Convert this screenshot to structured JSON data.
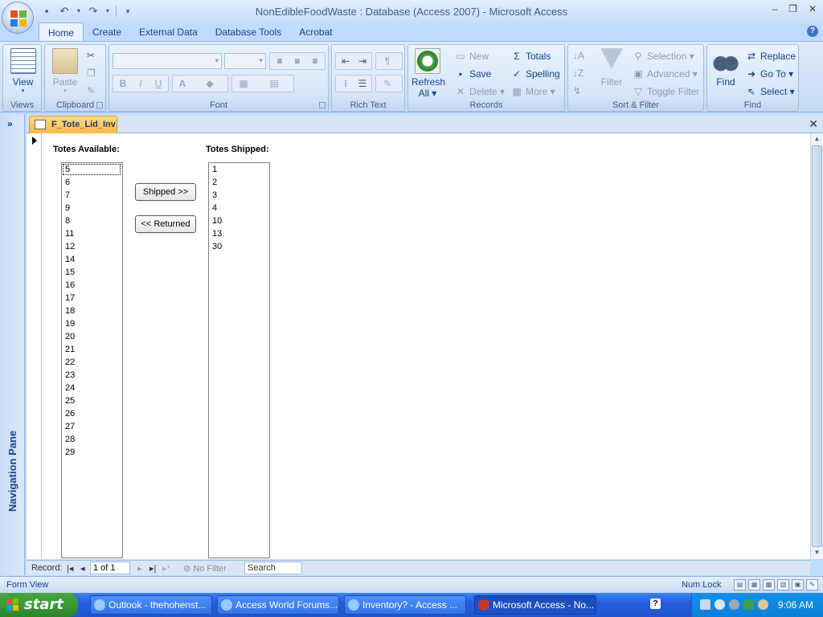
{
  "window": {
    "title": "NonEdibleFoodWaste : Database (Access 2007) - Microsoft Access",
    "controls": [
      "–",
      "❐",
      "✕"
    ]
  },
  "ribbon": {
    "tabs": [
      "Home",
      "Create",
      "External Data",
      "Database Tools",
      "Acrobat"
    ],
    "active_tab": "Home",
    "groups": {
      "views": {
        "label": "Views",
        "view": "View"
      },
      "clipboard": {
        "label": "Clipboard",
        "paste": "Paste"
      },
      "font": {
        "label": "Font",
        "bold": "B",
        "italic": "I",
        "underline": "U",
        "color": "A"
      },
      "rich_text": {
        "label": "Rich Text"
      },
      "records": {
        "label": "Records",
        "refresh": "Refresh",
        "refresh_sub": "All ▾",
        "new": "New",
        "save": "Save",
        "delete": "Delete ▾",
        "totals": "Totals",
        "spelling": "Spelling",
        "more": "More ▾"
      },
      "sort_filter": {
        "label": "Sort & Filter",
        "filter": "Filter",
        "selection": "Selection ▾",
        "advanced": "Advanced ▾",
        "toggle": "Toggle Filter"
      },
      "find": {
        "label": "Find",
        "find": "Find",
        "replace": "Replace",
        "goto": "Go To ▾",
        "select": "Select ▾"
      }
    }
  },
  "nav_pane": {
    "label": "Navigation Pane",
    "toggle": "»"
  },
  "doc_tab": {
    "title": "F_Tote_Lid_Inv",
    "close": "✕"
  },
  "form": {
    "available_label": "Totes Available:",
    "shipped_label": "Totes Shipped:",
    "available": [
      "5",
      "6",
      "7",
      "9",
      "8",
      "11",
      "12",
      "14",
      "15",
      "16",
      "17",
      "18",
      "19",
      "20",
      "21",
      "22",
      "23",
      "24",
      "25",
      "26",
      "27",
      "28",
      "29"
    ],
    "shipped": [
      "1",
      "2",
      "3",
      "4",
      "10",
      "13",
      "30"
    ],
    "shipped_button": "Shipped >>",
    "returned_button": "<< Returned"
  },
  "record_nav": {
    "label": "Record:",
    "first": "|◂",
    "prev": "◂",
    "current": "1 of 1",
    "next": "▸",
    "last": "▸|",
    "new": "▸*",
    "filter": "No Filter",
    "search": "Search"
  },
  "status": {
    "left": "Form View",
    "numlock": "Num Lock"
  },
  "taskbar": {
    "start": "start",
    "tasks": [
      {
        "label": "Outlook - thehohenst...",
        "color": "#e8f0ff"
      },
      {
        "label": "Access World Forums...",
        "color": "#e8f0ff"
      },
      {
        "label": "Inventory? - Access ...",
        "color": "#e8f0ff"
      },
      {
        "label": "Microsoft Access - No...",
        "color": "#c0392b"
      }
    ],
    "clock": "9:06 AM"
  },
  "colors": {
    "accent": "#15428b",
    "tab_highlight": "#ffb940",
    "taskbar": "#245edb",
    "start": "#3c9a38"
  }
}
